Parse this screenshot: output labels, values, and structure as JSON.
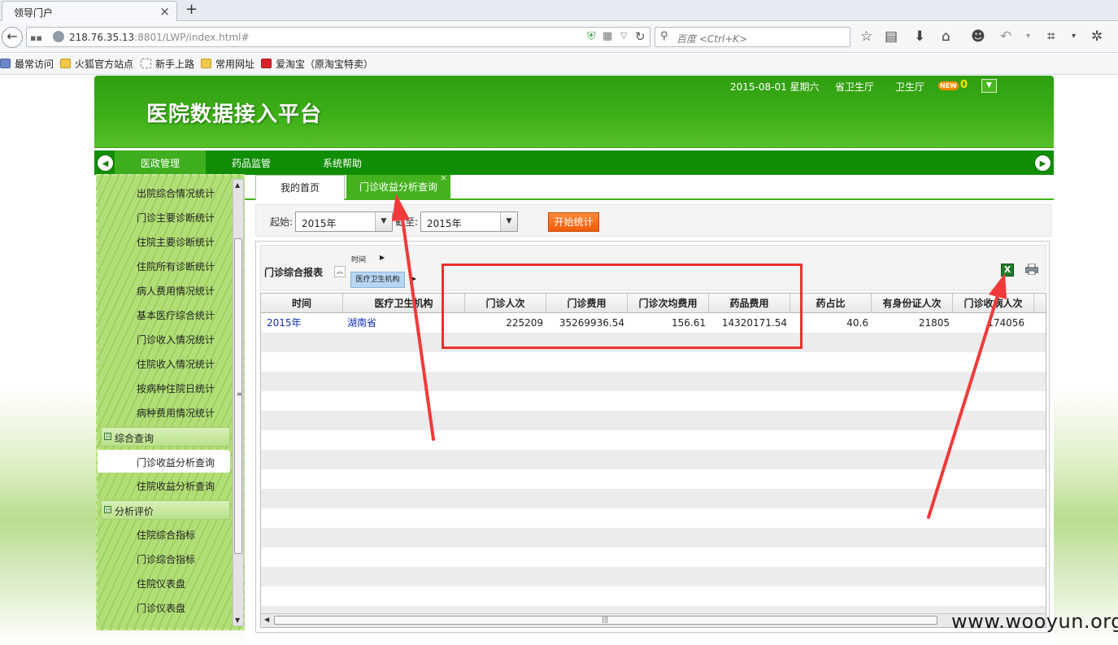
{
  "browser": {
    "tab_title": "领导门户",
    "tab_close": "×",
    "new_tab": "+",
    "url_host": "218.76.35.13",
    "url_rest": ":8801/LWP/index.html#",
    "search_placeholder": "百度 <Ctrl+K>",
    "bookmarks": [
      "最常访问",
      "火狐官方站点",
      "新手上路",
      "常用网址",
      "爱淘宝（原淘宝特卖）"
    ],
    "toolbar_icons": [
      "star-icon",
      "reader-icon",
      "download-icon",
      "home-icon",
      "chat-icon",
      "undo-icon",
      "crop-icon",
      "menu-icon"
    ]
  },
  "app": {
    "title": "医院数据接入平台",
    "date": "2015-08-01 星期六",
    "org_level": "省卫生厅",
    "org_name": "卫生厅",
    "new_badge": "NEW",
    "message_count": "0"
  },
  "nav": {
    "items": [
      "医政管理",
      "药品监管",
      "系统帮助"
    ],
    "active_index": 0
  },
  "sidebar": {
    "items": [
      "出院综合情况统计",
      "门诊主要诊断统计",
      "住院主要诊断统计",
      "住院所有诊断统计",
      "病人费用情况统计",
      "基本医疗综合统计",
      "门诊收入情况统计",
      "住院收入情况统计",
      "按病种住院日统计",
      "病种费用情况统计"
    ],
    "group_query": "综合查询",
    "query_items": [
      "门诊收益分析查询",
      "住院收益分析查询"
    ],
    "group_eval": "分析评价",
    "eval_items": [
      "住院综合指标",
      "门诊综合指标",
      "住院仪表盘",
      "门诊仪表盘"
    ],
    "group_toggle": "⊟"
  },
  "content": {
    "tab_home": "我的首页",
    "tab_active": "门诊收益分析查询",
    "tab_close": "×",
    "filter": {
      "from_label": "起始:",
      "from_value": "2015年",
      "to_label": "截至:",
      "to_value": "2015年",
      "button": "开始统计"
    },
    "report": {
      "title": "门诊综合报表",
      "dim_time": "时间",
      "dim_org": "医疗卫生机构",
      "excel_glyph": "X",
      "columns": [
        "时间",
        "医疗卫生机构",
        "门诊人次",
        "门诊费用",
        "门诊次均费用",
        "药品费用",
        "药占比",
        "有身份证人次",
        "门诊收病人次"
      ],
      "rows": [
        [
          "2015年",
          "湖南省",
          "225209",
          "35269936.54",
          "156.61",
          "14320171.54",
          "40.6",
          "21805",
          "174056"
        ]
      ]
    }
  },
  "watermark": "www.wooyun.org"
}
